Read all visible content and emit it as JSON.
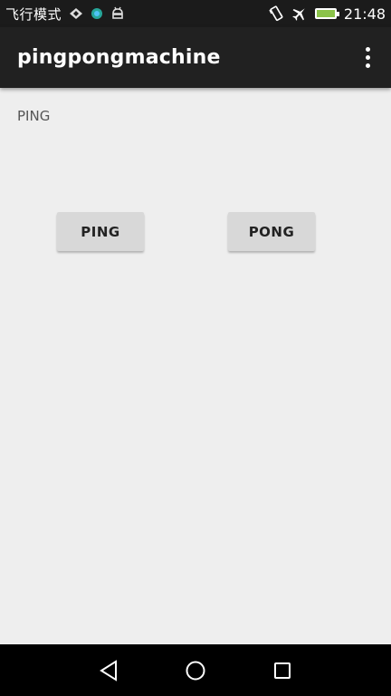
{
  "status_bar": {
    "carrier_text": "飞行模式",
    "time": "21:48",
    "icons": [
      "signal-icon",
      "app-notification-icon",
      "android-icon",
      "vibrate-icon",
      "airplane-mode-icon",
      "battery-charging-icon"
    ]
  },
  "app_bar": {
    "title": "pingpongmachine",
    "overflow_icon": "more-vert-icon"
  },
  "main": {
    "status_label": "PING",
    "ping_button": "PING",
    "pong_button": "PONG"
  },
  "nav_bar": {
    "icons": [
      "back-icon",
      "home-icon",
      "recents-icon"
    ]
  },
  "colors": {
    "app_bar": "#212121",
    "background": "#eeeeee",
    "button": "#d8d8d8"
  }
}
